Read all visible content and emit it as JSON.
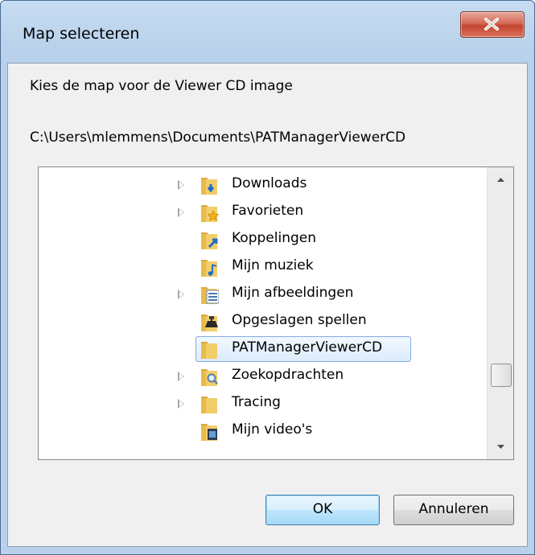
{
  "window": {
    "title": "Map selecteren",
    "close_label": "X"
  },
  "dialog": {
    "prompt": "Kies de map voor de Viewer CD image",
    "path": "C:\\Users\\mlemmens\\Documents\\PATManagerViewerCD"
  },
  "tree": {
    "items": [
      {
        "label": "Downloads",
        "icon": "downloads-folder-icon",
        "expandable": true,
        "selected": false
      },
      {
        "label": "Favorieten",
        "icon": "favorites-folder-icon",
        "expandable": true,
        "selected": false
      },
      {
        "label": "Koppelingen",
        "icon": "links-folder-icon",
        "expandable": false,
        "selected": false
      },
      {
        "label": "Mijn muziek",
        "icon": "music-folder-icon",
        "expandable": false,
        "selected": false
      },
      {
        "label": "Mijn afbeeldingen",
        "icon": "pictures-folder-icon",
        "expandable": true,
        "selected": false
      },
      {
        "label": "Opgeslagen spellen",
        "icon": "saved-games-folder-icon",
        "expandable": false,
        "selected": false
      },
      {
        "label": "PATManagerViewerCD",
        "icon": "folder-icon",
        "expandable": false,
        "selected": true
      },
      {
        "label": "Zoekopdrachten",
        "icon": "searches-folder-icon",
        "expandable": true,
        "selected": false
      },
      {
        "label": "Tracing",
        "icon": "folder-icon",
        "expandable": true,
        "selected": false
      },
      {
        "label": "Mijn video's",
        "icon": "videos-folder-icon",
        "expandable": false,
        "selected": false
      }
    ]
  },
  "buttons": {
    "ok": "OK",
    "cancel": "Annuleren"
  },
  "colors": {
    "folder": "#e8c05a",
    "selection": "#dcebfc",
    "selection_border": "#84acdd",
    "close": "#c2452f"
  }
}
